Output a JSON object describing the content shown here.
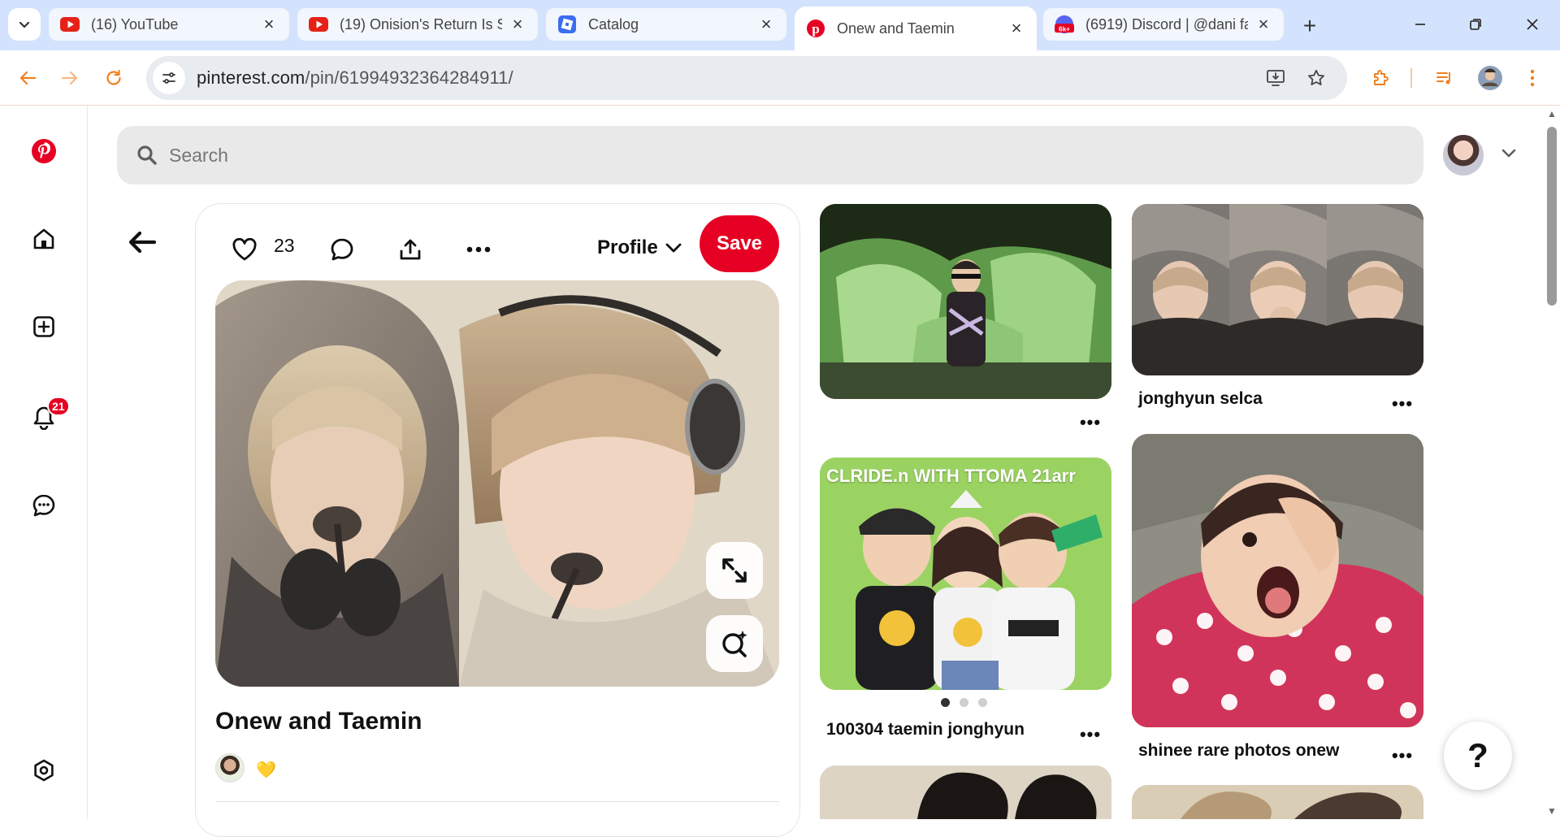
{
  "browser": {
    "tabs": [
      {
        "title": "(16) YouTube",
        "favicon": "youtube-icon",
        "active": false
      },
      {
        "title": "(19) Onision's Return Is S",
        "favicon": "youtube-icon",
        "active": false
      },
      {
        "title": "Catalog",
        "favicon": "roblox-icon",
        "active": false
      },
      {
        "title": "Onew and Taemin",
        "favicon": "pinterest-icon",
        "active": true
      },
      {
        "title": "(6919) Discord | @dani fa",
        "favicon": "discord-icon",
        "active": false
      }
    ],
    "url_host": "pinterest.com",
    "url_path": "/pin/619949323642849​11/",
    "accent_color": "#f08020"
  },
  "sidebar": {
    "notification_count": "21",
    "items": [
      "pinterest-logo-icon",
      "home-icon",
      "create-icon",
      "notifications-icon",
      "messages-icon",
      "settings-icon"
    ]
  },
  "search": {
    "placeholder": "Search",
    "value": ""
  },
  "pin": {
    "like_count": "23",
    "profile_label": "Profile",
    "save_label": "Save",
    "title": "Onew and Taemin",
    "reaction": "💛",
    "brand_color": "#e60023"
  },
  "grid": {
    "items": [
      {
        "caption": "",
        "more": "•••"
      },
      {
        "caption": "jonghyun selca",
        "more": "•••"
      },
      {
        "caption": "100304 taemin jonghyun",
        "more": "•••",
        "image_text": "CLRIDE.n WITH TTOMA 21arr"
      },
      {
        "caption": "shinee rare photos onew",
        "more": "•••"
      }
    ],
    "carousel_active": 1,
    "carousel_total": 3
  },
  "help": {
    "label": "?"
  }
}
